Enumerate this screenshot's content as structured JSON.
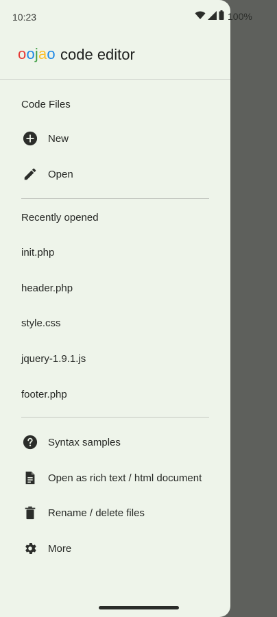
{
  "status_bar": {
    "time": "10:23",
    "battery": "100%"
  },
  "header": {
    "logo_letters": [
      {
        "char": "o",
        "color": "#e53935"
      },
      {
        "char": "o",
        "color": "#1e88e5"
      },
      {
        "char": "j",
        "color": "#43a047"
      },
      {
        "char": "a",
        "color": "#fbc02d"
      },
      {
        "char": "o",
        "color": "#1e88e5"
      }
    ],
    "app_name": "code editor"
  },
  "code_files": {
    "title": "Code Files",
    "new_label": "New",
    "open_label": "Open"
  },
  "recent": {
    "title": "Recently opened",
    "files": [
      "init.php",
      "header.php",
      "style.css",
      "jquery-1.9.1.js",
      "footer.php"
    ]
  },
  "more_menu": {
    "syntax_label": "Syntax samples",
    "rich_text_label": "Open as rich text / html document",
    "rename_label": "Rename / delete files",
    "more_label": "More"
  },
  "colors": {
    "drawer_bg": "#eef4ea",
    "scrim": "#5e605c",
    "icon": "#2b2d2a"
  }
}
